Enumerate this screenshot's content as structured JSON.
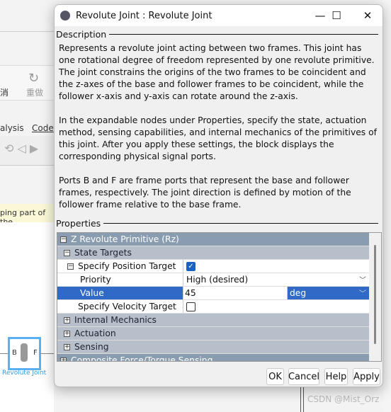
{
  "background": {
    "undo_label": "消",
    "redo_label": "重做",
    "menu_analysis": "alysis",
    "menu_code": "Code",
    "hint_text": "ping part of the",
    "block_label": "Revolute Joint",
    "port_b": "B",
    "port_f": "F",
    "watermark": "CSDN @Mist_Orz"
  },
  "dialog": {
    "title": "Revolute Joint : Revolute Joint",
    "description_heading": "Description",
    "description": [
      "Represents a revolute joint acting between two frames. This joint has one rotational degree of freedom represented by one revolute primitive. The joint constrains the origins of the two frames to be coincident and the z-axes of the base and follower frames to be coincident, while the follower x-axis and y-axis can rotate around the z-axis.",
      "In the expandable nodes under Properties, specify the state, actuation method, sensing capabilities, and internal mechanics of the primitives of this joint. After you apply these settings, the block displays the corresponding physical signal ports.",
      "Ports B and F are frame ports that represent the base and follower frames, respectively. The joint direction is defined by motion of the follower frame relative to the base frame."
    ],
    "properties_heading": "Properties",
    "tree": {
      "primitive": "Z Revolute Primitive (Rz)",
      "state_targets": "State Targets",
      "position_target": "Specify Position Target",
      "position_target_checked": true,
      "priority_label": "Priority",
      "priority_value": "High (desired)",
      "value_label": "Value",
      "value_value": "45",
      "value_unit": "deg",
      "velocity_target": "Specify Velocity Target",
      "velocity_target_checked": false,
      "internal_mechanics": "Internal Mechanics",
      "actuation": "Actuation",
      "sensing": "Sensing",
      "composite": "Composite Force/Torque Sensing"
    },
    "buttons": {
      "ok": "OK",
      "cancel": "Cancel",
      "help": "Help",
      "apply": "Apply"
    }
  }
}
